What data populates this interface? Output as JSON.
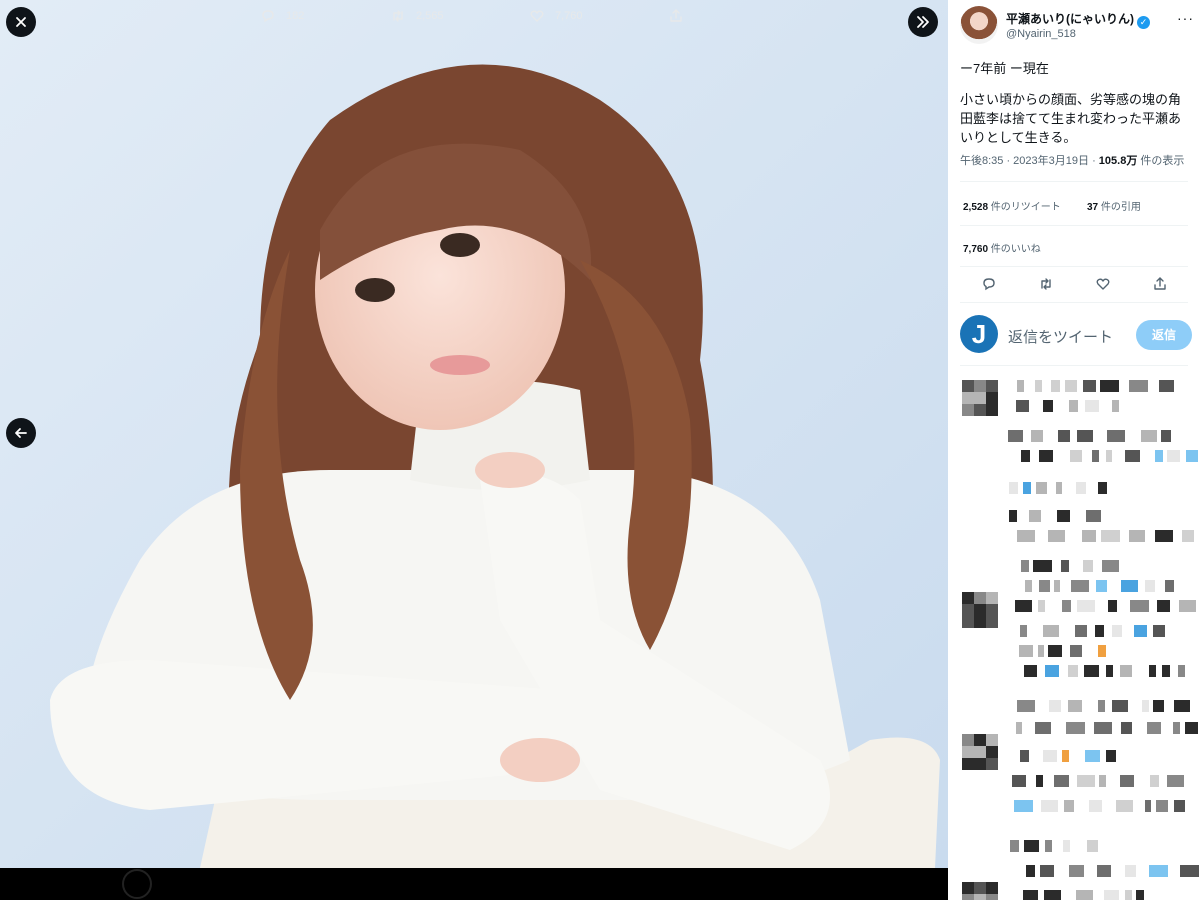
{
  "viewer": {
    "close_icon": "close-icon",
    "next_icon": "chevron-double-right-icon",
    "prev_icon": "arrow-left-icon",
    "bottom_bar": {
      "reply_count": "182",
      "retweet_count": "2,565",
      "like_count": "7,760"
    }
  },
  "tweet": {
    "author_name": "平瀬あいり(にゃいりん)",
    "author_handle": "@Nyairin_518",
    "line1": "ー7年前 ー現在",
    "body": "小さい頃からの顔面、劣等感の塊の角田藍李は捨てて生まれ変わった平瀬あいりとして生きる。",
    "time": "午後8:35 · 2023年3月19日 · ",
    "views": "105.8万",
    "views_label": " 件の表示",
    "retweets": "2,528",
    "retweets_label": " 件のリツイート",
    "quotes": "37",
    "quotes_label": " 件の引用",
    "likes": "7,760",
    "likes_label": " 件のいいね"
  },
  "reply": {
    "avatar_letter": "J",
    "placeholder": "返信をツイート",
    "button_label": "返信"
  },
  "colors": {
    "accent": "#1d9bf0",
    "photo_bg": "#d3e3f1",
    "bar_bg": "#000000"
  }
}
